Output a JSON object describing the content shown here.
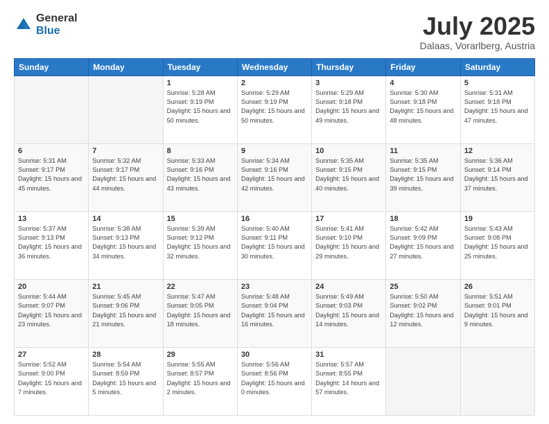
{
  "logo": {
    "general": "General",
    "blue": "Blue"
  },
  "header": {
    "title": "July 2025",
    "subtitle": "Dalaas, Vorarlberg, Austria"
  },
  "weekdays": [
    "Sunday",
    "Monday",
    "Tuesday",
    "Wednesday",
    "Thursday",
    "Friday",
    "Saturday"
  ],
  "weeks": [
    [
      {
        "day": "",
        "empty": true
      },
      {
        "day": "",
        "empty": true
      },
      {
        "day": "1",
        "sunrise": "Sunrise: 5:28 AM",
        "sunset": "Sunset: 9:19 PM",
        "daylight": "Daylight: 15 hours and 50 minutes."
      },
      {
        "day": "2",
        "sunrise": "Sunrise: 5:29 AM",
        "sunset": "Sunset: 9:19 PM",
        "daylight": "Daylight: 15 hours and 50 minutes."
      },
      {
        "day": "3",
        "sunrise": "Sunrise: 5:29 AM",
        "sunset": "Sunset: 9:18 PM",
        "daylight": "Daylight: 15 hours and 49 minutes."
      },
      {
        "day": "4",
        "sunrise": "Sunrise: 5:30 AM",
        "sunset": "Sunset: 9:18 PM",
        "daylight": "Daylight: 15 hours and 48 minutes."
      },
      {
        "day": "5",
        "sunrise": "Sunrise: 5:31 AM",
        "sunset": "Sunset: 9:18 PM",
        "daylight": "Daylight: 15 hours and 47 minutes."
      }
    ],
    [
      {
        "day": "6",
        "sunrise": "Sunrise: 5:31 AM",
        "sunset": "Sunset: 9:17 PM",
        "daylight": "Daylight: 15 hours and 45 minutes."
      },
      {
        "day": "7",
        "sunrise": "Sunrise: 5:32 AM",
        "sunset": "Sunset: 9:17 PM",
        "daylight": "Daylight: 15 hours and 44 minutes."
      },
      {
        "day": "8",
        "sunrise": "Sunrise: 5:33 AM",
        "sunset": "Sunset: 9:16 PM",
        "daylight": "Daylight: 15 hours and 43 minutes."
      },
      {
        "day": "9",
        "sunrise": "Sunrise: 5:34 AM",
        "sunset": "Sunset: 9:16 PM",
        "daylight": "Daylight: 15 hours and 42 minutes."
      },
      {
        "day": "10",
        "sunrise": "Sunrise: 5:35 AM",
        "sunset": "Sunset: 9:15 PM",
        "daylight": "Daylight: 15 hours and 40 minutes."
      },
      {
        "day": "11",
        "sunrise": "Sunrise: 5:35 AM",
        "sunset": "Sunset: 9:15 PM",
        "daylight": "Daylight: 15 hours and 39 minutes."
      },
      {
        "day": "12",
        "sunrise": "Sunrise: 5:36 AM",
        "sunset": "Sunset: 9:14 PM",
        "daylight": "Daylight: 15 hours and 37 minutes."
      }
    ],
    [
      {
        "day": "13",
        "sunrise": "Sunrise: 5:37 AM",
        "sunset": "Sunset: 9:13 PM",
        "daylight": "Daylight: 15 hours and 36 minutes."
      },
      {
        "day": "14",
        "sunrise": "Sunrise: 5:38 AM",
        "sunset": "Sunset: 9:13 PM",
        "daylight": "Daylight: 15 hours and 34 minutes."
      },
      {
        "day": "15",
        "sunrise": "Sunrise: 5:39 AM",
        "sunset": "Sunset: 9:12 PM",
        "daylight": "Daylight: 15 hours and 32 minutes."
      },
      {
        "day": "16",
        "sunrise": "Sunrise: 5:40 AM",
        "sunset": "Sunset: 9:11 PM",
        "daylight": "Daylight: 15 hours and 30 minutes."
      },
      {
        "day": "17",
        "sunrise": "Sunrise: 5:41 AM",
        "sunset": "Sunset: 9:10 PM",
        "daylight": "Daylight: 15 hours and 29 minutes."
      },
      {
        "day": "18",
        "sunrise": "Sunrise: 5:42 AM",
        "sunset": "Sunset: 9:09 PM",
        "daylight": "Daylight: 15 hours and 27 minutes."
      },
      {
        "day": "19",
        "sunrise": "Sunrise: 5:43 AM",
        "sunset": "Sunset: 9:08 PM",
        "daylight": "Daylight: 15 hours and 25 minutes."
      }
    ],
    [
      {
        "day": "20",
        "sunrise": "Sunrise: 5:44 AM",
        "sunset": "Sunset: 9:07 PM",
        "daylight": "Daylight: 15 hours and 23 minutes."
      },
      {
        "day": "21",
        "sunrise": "Sunrise: 5:45 AM",
        "sunset": "Sunset: 9:06 PM",
        "daylight": "Daylight: 15 hours and 21 minutes."
      },
      {
        "day": "22",
        "sunrise": "Sunrise: 5:47 AM",
        "sunset": "Sunset: 9:05 PM",
        "daylight": "Daylight: 15 hours and 18 minutes."
      },
      {
        "day": "23",
        "sunrise": "Sunrise: 5:48 AM",
        "sunset": "Sunset: 9:04 PM",
        "daylight": "Daylight: 15 hours and 16 minutes."
      },
      {
        "day": "24",
        "sunrise": "Sunrise: 5:49 AM",
        "sunset": "Sunset: 9:03 PM",
        "daylight": "Daylight: 15 hours and 14 minutes."
      },
      {
        "day": "25",
        "sunrise": "Sunrise: 5:50 AM",
        "sunset": "Sunset: 9:02 PM",
        "daylight": "Daylight: 15 hours and 12 minutes."
      },
      {
        "day": "26",
        "sunrise": "Sunrise: 5:51 AM",
        "sunset": "Sunset: 9:01 PM",
        "daylight": "Daylight: 15 hours and 9 minutes."
      }
    ],
    [
      {
        "day": "27",
        "sunrise": "Sunrise: 5:52 AM",
        "sunset": "Sunset: 9:00 PM",
        "daylight": "Daylight: 15 hours and 7 minutes."
      },
      {
        "day": "28",
        "sunrise": "Sunrise: 5:54 AM",
        "sunset": "Sunset: 8:59 PM",
        "daylight": "Daylight: 15 hours and 5 minutes."
      },
      {
        "day": "29",
        "sunrise": "Sunrise: 5:55 AM",
        "sunset": "Sunset: 8:57 PM",
        "daylight": "Daylight: 15 hours and 2 minutes."
      },
      {
        "day": "30",
        "sunrise": "Sunrise: 5:56 AM",
        "sunset": "Sunset: 8:56 PM",
        "daylight": "Daylight: 15 hours and 0 minutes."
      },
      {
        "day": "31",
        "sunrise": "Sunrise: 5:57 AM",
        "sunset": "Sunset: 8:55 PM",
        "daylight": "Daylight: 14 hours and 57 minutes."
      },
      {
        "day": "",
        "empty": true
      },
      {
        "day": "",
        "empty": true
      }
    ]
  ]
}
